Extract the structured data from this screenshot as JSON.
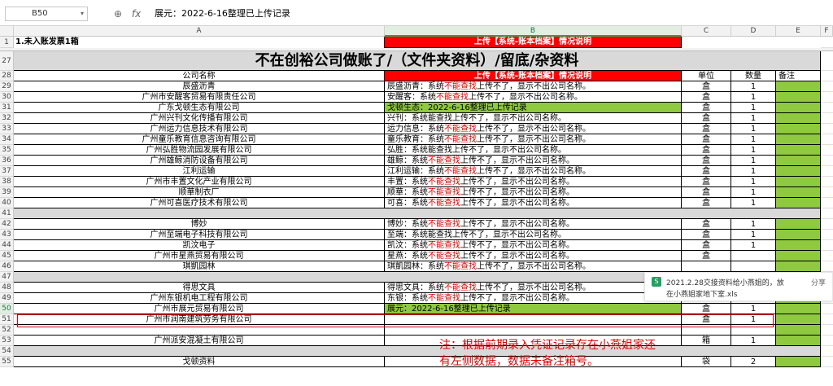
{
  "formula_bar": {
    "cell_ref": "B50",
    "formula": "展元：2022-6-16整理已上传记录",
    "fx_label": "fx"
  },
  "columns": [
    "A",
    "B",
    "C",
    "D",
    "E",
    "F"
  ],
  "row1": {
    "num": "1",
    "a": "1.未入账发票1箱",
    "b": "上传【系统-账本档案】情况说明"
  },
  "row27": {
    "num": "27",
    "title": "不在创裕公司做账了/（文件夹资料）/留底/杂资料"
  },
  "row28": {
    "num": "28",
    "a": "公司名称",
    "b": "上传【系统-账本档案】情况说明",
    "c": "单位",
    "d": "数量",
    "e": "备注"
  },
  "rows": [
    {
      "num": "29",
      "a": "辰盛沥青",
      "b": [
        "辰盛沥青：系统",
        "不能查找",
        "上传不了，显示不出公司名称。"
      ],
      "c": "盒",
      "d": "1"
    },
    {
      "num": "30",
      "a": "广州市安醒客贸易有限责任公司",
      "b": [
        "安醒客：系统",
        "不能查找",
        "上传不了，显示不出公司名称。"
      ],
      "c": "盒",
      "d": "1"
    },
    {
      "num": "31",
      "a": "广东戈顿生态有限公司",
      "b": [
        "戈顿生态：2022-6-16整理已上传记录"
      ],
      "c": "盒",
      "d": "1",
      "green_b": true
    },
    {
      "num": "32",
      "a": "广州兴刊文化传播有限公司",
      "b": [
        "兴刊：系统能查找上传不了，显示不出公司名称。"
      ],
      "c": "盒",
      "d": "1"
    },
    {
      "num": "33",
      "a": "广州运力信息技术有限公司",
      "b": [
        "运力信息：系统",
        "不能查找",
        "上传不了，显示不出公司名称。"
      ],
      "c": "盒",
      "d": "1"
    },
    {
      "num": "34",
      "a": "广州童乐教育信息咨询有限公司",
      "b": [
        "童乐教育：系统",
        "不能查找",
        "上传不了，显示不出公司名称。"
      ],
      "c": "盒",
      "d": "1"
    },
    {
      "num": "35",
      "a": "广州弘胜物流园发展有限公司",
      "b": [
        "弘胜：系统能查找上传不了，显示不出公司名称。"
      ],
      "c": "盒",
      "d": "1"
    },
    {
      "num": "36",
      "a": "广州雄鲸消防设备有限公司",
      "b": [
        "雄鲸：系统",
        "不能查找",
        "上传不了，显示不出公司名称。"
      ],
      "c": "盒",
      "d": "1"
    },
    {
      "num": "37",
      "a": "江利运输",
      "b": [
        "江利运输：系统",
        "不能查找",
        "上传不了，显示不出公司名称。"
      ],
      "c": "盒",
      "d": "1"
    },
    {
      "num": "38",
      "a": "广州市丰置文化产业有限公司",
      "b": [
        "丰置：系统",
        "不能查找",
        "上传不了，显示不出公司名称。"
      ],
      "c": "盒",
      "d": "1"
    },
    {
      "num": "39",
      "a": "顺華制衣厂",
      "b": [
        "顺華：系统",
        "不能查找",
        "上传不了，显示不出公司名称。"
      ],
      "c": "盒",
      "d": "1"
    },
    {
      "num": "40",
      "a": "广州可喜医疗技术有限公司",
      "b": [
        "可喜：系统",
        "不能查找",
        "上传不了，显示不出公司名称。"
      ],
      "c": "盒",
      "d": "1"
    },
    {
      "num": "41",
      "sep": true
    },
    {
      "num": "42",
      "a": "博妙",
      "b": [
        "博妙：系统",
        "不能查找",
        "上传不了，显示不出公司名称。"
      ],
      "c": "盒",
      "d": "1"
    },
    {
      "num": "43",
      "a": "广州至端电子科技有限公司",
      "b": [
        "至端：系统能查找上传不了，显示不出公司名称。"
      ],
      "c": "盒",
      "d": "1"
    },
    {
      "num": "44",
      "a": "凯汶电子",
      "b": [
        "凯汶：系统",
        "不能查找",
        "上传不了，显示不出公司名称。"
      ],
      "c": "盒",
      "d": "1"
    },
    {
      "num": "45",
      "a": "广州市星燕贸易有限公司",
      "b": [
        "星燕：系统",
        "不能查找",
        "上传不了，显示不出公司名称。"
      ],
      "c": "盒",
      "d": ""
    },
    {
      "num": "46",
      "a": "琪凱园林",
      "b": [
        "琪凱园林：系统",
        "不能查找",
        "上传不了，显示不出公司名称。"
      ],
      "c": "",
      "d": ""
    },
    {
      "num": "47",
      "sep": true
    },
    {
      "num": "48",
      "a": "得思文具",
      "b": [
        "得思文具：系统",
        "不能查找",
        "上传不了，显示不出公司名称。"
      ],
      "c": "",
      "d": ""
    },
    {
      "num": "49",
      "a": "广州东银机电工程有限公司",
      "b": [
        "东银：系统",
        "不能查找",
        "上传不了，显示不出公司名称。"
      ],
      "c": "",
      "d": ""
    },
    {
      "num": "50",
      "a": "广州市展元贸易有限公司",
      "b": [
        "展元：2022-6-16整理已上传记录"
      ],
      "c": "盒",
      "d": "1",
      "green_b": true,
      "selected": true
    },
    {
      "num": "51",
      "a": "广州市润南建筑劳务有限公司",
      "b": [
        ""
      ],
      "c": "盒",
      "d": "1"
    },
    {
      "num": "52",
      "a": "",
      "b": [
        ""
      ],
      "c": "",
      "d": ""
    },
    {
      "num": "53",
      "a": "广州派安混凝土有限公司",
      "b": [
        ""
      ],
      "c": "箱",
      "d": "1"
    },
    {
      "num": "54",
      "sep": true
    },
    {
      "num": "55",
      "a": "戈顿资料",
      "b": [
        ""
      ],
      "c": "袋",
      "d": "2"
    }
  ],
  "popup": {
    "icon": "S",
    "line1": "2021.2.28交接资料给小燕姐的，放",
    "line2": "在小燕姐家地下室.xls",
    "share": "分享"
  },
  "annotation": {
    "line1": "注：根据前期录入凭证记录存在小燕姐家还",
    "line2": "有左侧数据，数据未备注箱号。"
  },
  "colors": {
    "green": "#8fc93f",
    "red": "#ff0000",
    "separator": "#d9d9d9"
  }
}
